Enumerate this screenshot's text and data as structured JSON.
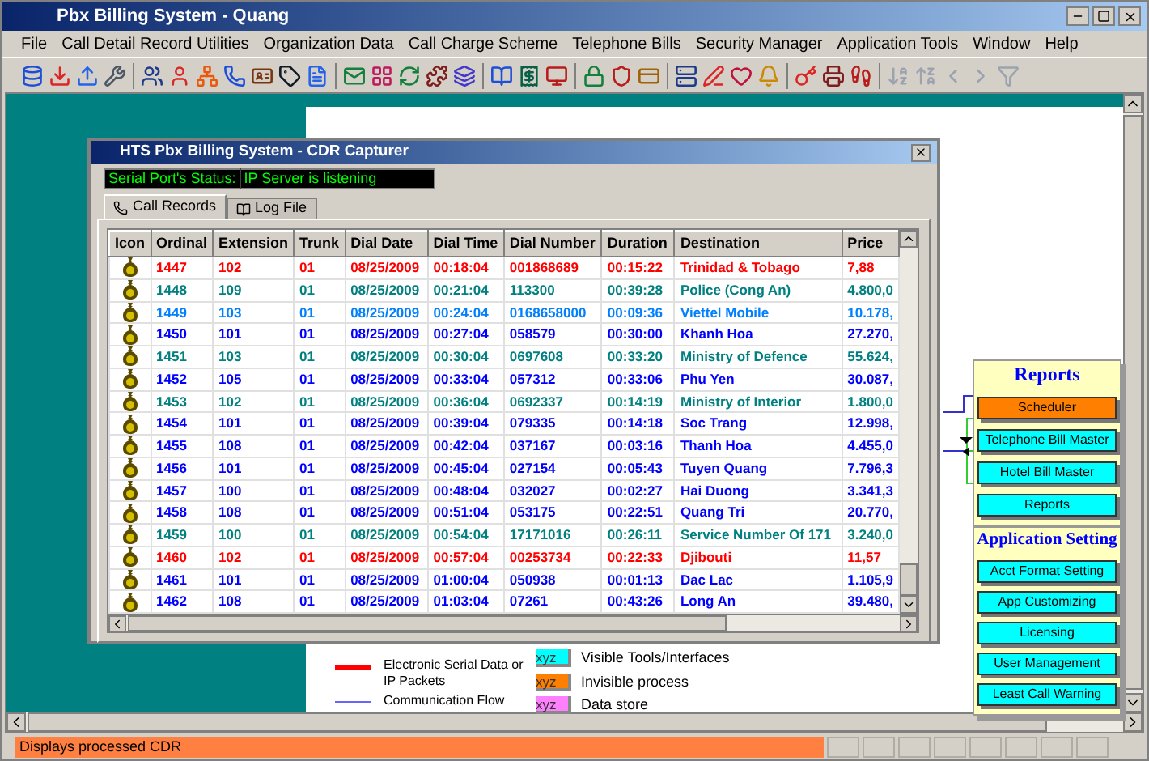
{
  "window": {
    "title": "Pbx Billing System - Quang"
  },
  "menu": [
    "File",
    "Call Detail Record Utilities",
    "Organization Data",
    "Call Charge Scheme",
    "Telephone Bills",
    "Security Manager",
    "Application Tools",
    "Window",
    "Help"
  ],
  "dialog": {
    "title": "HTS Pbx Billing System - CDR Capturer",
    "status_label": "Serial Port's Status:",
    "status_value": "IP Server is listening",
    "tabs": [
      {
        "label": "Call Records",
        "selected": true
      },
      {
        "label": "Log File",
        "selected": false
      }
    ],
    "columns": [
      "Icon",
      "Ordinal",
      "Extension",
      "Trunk",
      "Dial Date",
      "Dial Time",
      "Dial Number",
      "Duration",
      "Destination",
      "Price"
    ],
    "rows": [
      {
        "color": "#ff0000",
        "cells": [
          "",
          "1447",
          "102",
          "01",
          "08/25/2009",
          "00:18:04",
          "001868689",
          "00:15:22",
          "Trinidad & Tobago",
          "7,88"
        ]
      },
      {
        "color": "#008080",
        "cells": [
          "",
          "1448",
          "109",
          "01",
          "08/25/2009",
          "00:21:04",
          "113300",
          "00:39:28",
          "Police (Cong An)",
          "4.800,0"
        ]
      },
      {
        "color": "#0080ff",
        "cells": [
          "",
          "1449",
          "103",
          "01",
          "08/25/2009",
          "00:24:04",
          "0168658000",
          "00:09:36",
          "Viettel Mobile",
          "10.178,"
        ]
      },
      {
        "color": "#0000ff",
        "cells": [
          "",
          "1450",
          "101",
          "01",
          "08/25/2009",
          "00:27:04",
          "058579",
          "00:30:00",
          "Khanh Hoa",
          "27.270,"
        ]
      },
      {
        "color": "#008080",
        "cells": [
          "",
          "1451",
          "103",
          "01",
          "08/25/2009",
          "00:30:04",
          "0697608",
          "00:33:20",
          "Ministry of Defence",
          "55.624,"
        ]
      },
      {
        "color": "#0000ff",
        "cells": [
          "",
          "1452",
          "105",
          "01",
          "08/25/2009",
          "00:33:04",
          "057312",
          "00:33:06",
          "Phu Yen",
          "30.087,"
        ]
      },
      {
        "color": "#008080",
        "cells": [
          "",
          "1453",
          "102",
          "01",
          "08/25/2009",
          "00:36:04",
          "0692337",
          "00:14:19",
          "Ministry of Interior",
          "1.800,0"
        ]
      },
      {
        "color": "#0000ff",
        "cells": [
          "",
          "1454",
          "101",
          "01",
          "08/25/2009",
          "00:39:04",
          "079335",
          "00:14:18",
          "Soc Trang",
          "12.998,"
        ]
      },
      {
        "color": "#0000ff",
        "cells": [
          "",
          "1455",
          "108",
          "01",
          "08/25/2009",
          "00:42:04",
          "037167",
          "00:03:16",
          "Thanh Hoa",
          "4.455,0"
        ]
      },
      {
        "color": "#0000ff",
        "cells": [
          "",
          "1456",
          "101",
          "01",
          "08/25/2009",
          "00:45:04",
          "027154",
          "00:05:43",
          "Tuyen Quang",
          "7.796,3"
        ]
      },
      {
        "color": "#0000ff",
        "cells": [
          "",
          "1457",
          "100",
          "01",
          "08/25/2009",
          "00:48:04",
          "032027",
          "00:02:27",
          "Hai Duong",
          "3.341,3"
        ]
      },
      {
        "color": "#0000ff",
        "cells": [
          "",
          "1458",
          "108",
          "01",
          "08/25/2009",
          "00:51:04",
          "053175",
          "00:22:51",
          "Quang Tri",
          "20.770,"
        ]
      },
      {
        "color": "#008080",
        "cells": [
          "",
          "1459",
          "100",
          "01",
          "08/25/2009",
          "00:54:04",
          "17171016",
          "00:26:11",
          "Service Number Of 171",
          "3.240,0"
        ]
      },
      {
        "color": "#ff0000",
        "cells": [
          "",
          "1460",
          "102",
          "01",
          "08/25/2009",
          "00:57:04",
          "00253734",
          "00:22:33",
          "Djibouti",
          "11,57"
        ]
      },
      {
        "color": "#0000ff",
        "cells": [
          "",
          "1461",
          "101",
          "01",
          "08/25/2009",
          "01:00:04",
          "050938",
          "00:01:13",
          "Dac Lac",
          "1.105,9"
        ]
      },
      {
        "color": "#0000ff",
        "cells": [
          "",
          "1462",
          "108",
          "01",
          "08/25/2009",
          "01:03:04",
          "07261",
          "00:43:26",
          "Long An",
          "39.480,"
        ]
      }
    ]
  },
  "reports": {
    "title": "Reports",
    "items": [
      {
        "label": "Scheduler",
        "kind": "process"
      },
      {
        "label": "Telephone Bill Master",
        "kind": "tool"
      },
      {
        "label": "Hotel Bill Master",
        "kind": "tool"
      },
      {
        "label": "Reports",
        "kind": "tool"
      }
    ]
  },
  "app_setting": {
    "title": "Application Setting",
    "items": [
      {
        "label": "Acct Format Setting",
        "kind": "tool"
      },
      {
        "label": "App Customizing",
        "kind": "tool"
      },
      {
        "label": "Licensing",
        "kind": "tool"
      },
      {
        "label": "User Management",
        "kind": "tool"
      },
      {
        "label": "Least Call Warning",
        "kind": "tool"
      }
    ]
  },
  "legend": {
    "lines": [
      {
        "label": "Electronic Serial Data or IP Packets",
        "color": "#ff0000"
      },
      {
        "label": "Communication Flow",
        "color": "#6666ff"
      }
    ],
    "swatches": [
      {
        "sample": "xyz",
        "label": "Visible Tools/Interfaces",
        "color": "#00ffff"
      },
      {
        "sample": "xyz",
        "label": "Invisible process",
        "color": "#ff8000"
      },
      {
        "sample": "xyz",
        "label": "Data store",
        "color": "#ff80ff"
      }
    ]
  },
  "status_bar": {
    "text": "Displays processed CDR"
  }
}
